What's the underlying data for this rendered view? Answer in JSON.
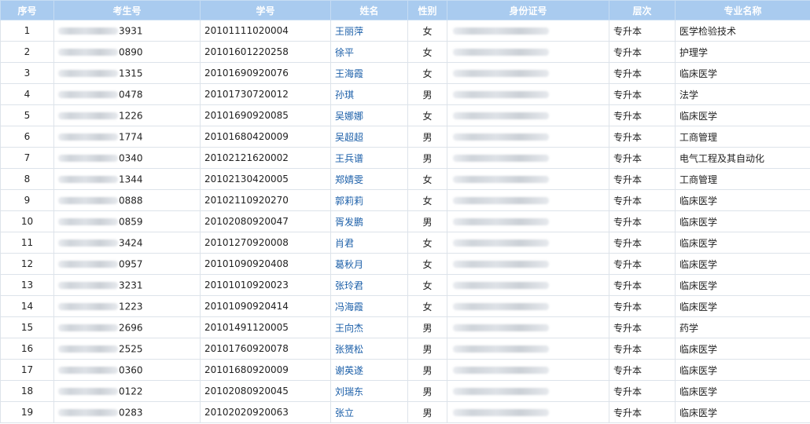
{
  "headers": [
    "序号",
    "考生号",
    "学号",
    "姓名",
    "性别",
    "身份证号",
    "层次",
    "专业名称"
  ],
  "rows": [
    {
      "idx": "1",
      "exam_suffix": "3931",
      "student_id": "20101111020004",
      "name": "王丽萍",
      "gender": "女",
      "level": "专升本",
      "major": "医学检验技术"
    },
    {
      "idx": "2",
      "exam_suffix": "0890",
      "student_id": "20101601220258",
      "name": "徐平",
      "gender": "女",
      "level": "专升本",
      "major": "护理学"
    },
    {
      "idx": "3",
      "exam_suffix": "1315",
      "student_id": "20101690920076",
      "name": "王海霞",
      "gender": "女",
      "level": "专升本",
      "major": "临床医学"
    },
    {
      "idx": "4",
      "exam_suffix": "0478",
      "student_id": "20101730720012",
      "name": "孙琪",
      "gender": "男",
      "level": "专升本",
      "major": "法学"
    },
    {
      "idx": "5",
      "exam_suffix": "1226",
      "student_id": "20101690920085",
      "name": "吴娜娜",
      "gender": "女",
      "level": "专升本",
      "major": "临床医学"
    },
    {
      "idx": "6",
      "exam_suffix": "1774",
      "student_id": "20101680420009",
      "name": "吴超超",
      "gender": "男",
      "level": "专升本",
      "major": "工商管理"
    },
    {
      "idx": "7",
      "exam_suffix": "0340",
      "student_id": "20102121620002",
      "name": "王兵谱",
      "gender": "男",
      "level": "专升本",
      "major": "电气工程及其自动化"
    },
    {
      "idx": "8",
      "exam_suffix": "1344",
      "student_id": "20102130420005",
      "name": "郑婧雯",
      "gender": "女",
      "level": "专升本",
      "major": "工商管理"
    },
    {
      "idx": "9",
      "exam_suffix": "0888",
      "student_id": "20102110920270",
      "name": "郭莉莉",
      "gender": "女",
      "level": "专升本",
      "major": "临床医学"
    },
    {
      "idx": "10",
      "exam_suffix": "0859",
      "student_id": "20102080920047",
      "name": "胥发鹏",
      "gender": "男",
      "level": "专升本",
      "major": "临床医学"
    },
    {
      "idx": "11",
      "exam_suffix": "3424",
      "student_id": "20101270920008",
      "name": "肖君",
      "gender": "女",
      "level": "专升本",
      "major": "临床医学"
    },
    {
      "idx": "12",
      "exam_suffix": "0957",
      "student_id": "20101090920408",
      "name": "葛秋月",
      "gender": "女",
      "level": "专升本",
      "major": "临床医学"
    },
    {
      "idx": "13",
      "exam_suffix": "3231",
      "student_id": "20101010920023",
      "name": "张玲君",
      "gender": "女",
      "level": "专升本",
      "major": "临床医学"
    },
    {
      "idx": "14",
      "exam_suffix": "1223",
      "student_id": "20101090920414",
      "name": "冯海霞",
      "gender": "女",
      "level": "专升本",
      "major": "临床医学"
    },
    {
      "idx": "15",
      "exam_suffix": "2696",
      "student_id": "20101491120005",
      "name": "王向杰",
      "gender": "男",
      "level": "专升本",
      "major": "药学"
    },
    {
      "idx": "16",
      "exam_suffix": "2525",
      "student_id": "20101760920078",
      "name": "张赟松",
      "gender": "男",
      "level": "专升本",
      "major": "临床医学"
    },
    {
      "idx": "17",
      "exam_suffix": "0360",
      "student_id": "20101680920009",
      "name": "谢英遂",
      "gender": "男",
      "level": "专升本",
      "major": "临床医学"
    },
    {
      "idx": "18",
      "exam_suffix": "0122",
      "student_id": "20102080920045",
      "name": "刘瑞东",
      "gender": "男",
      "level": "专升本",
      "major": "临床医学"
    },
    {
      "idx": "19",
      "exam_suffix": "0283",
      "student_id": "20102020920063",
      "name": "张立",
      "gender": "男",
      "level": "专升本",
      "major": "临床医学"
    }
  ]
}
